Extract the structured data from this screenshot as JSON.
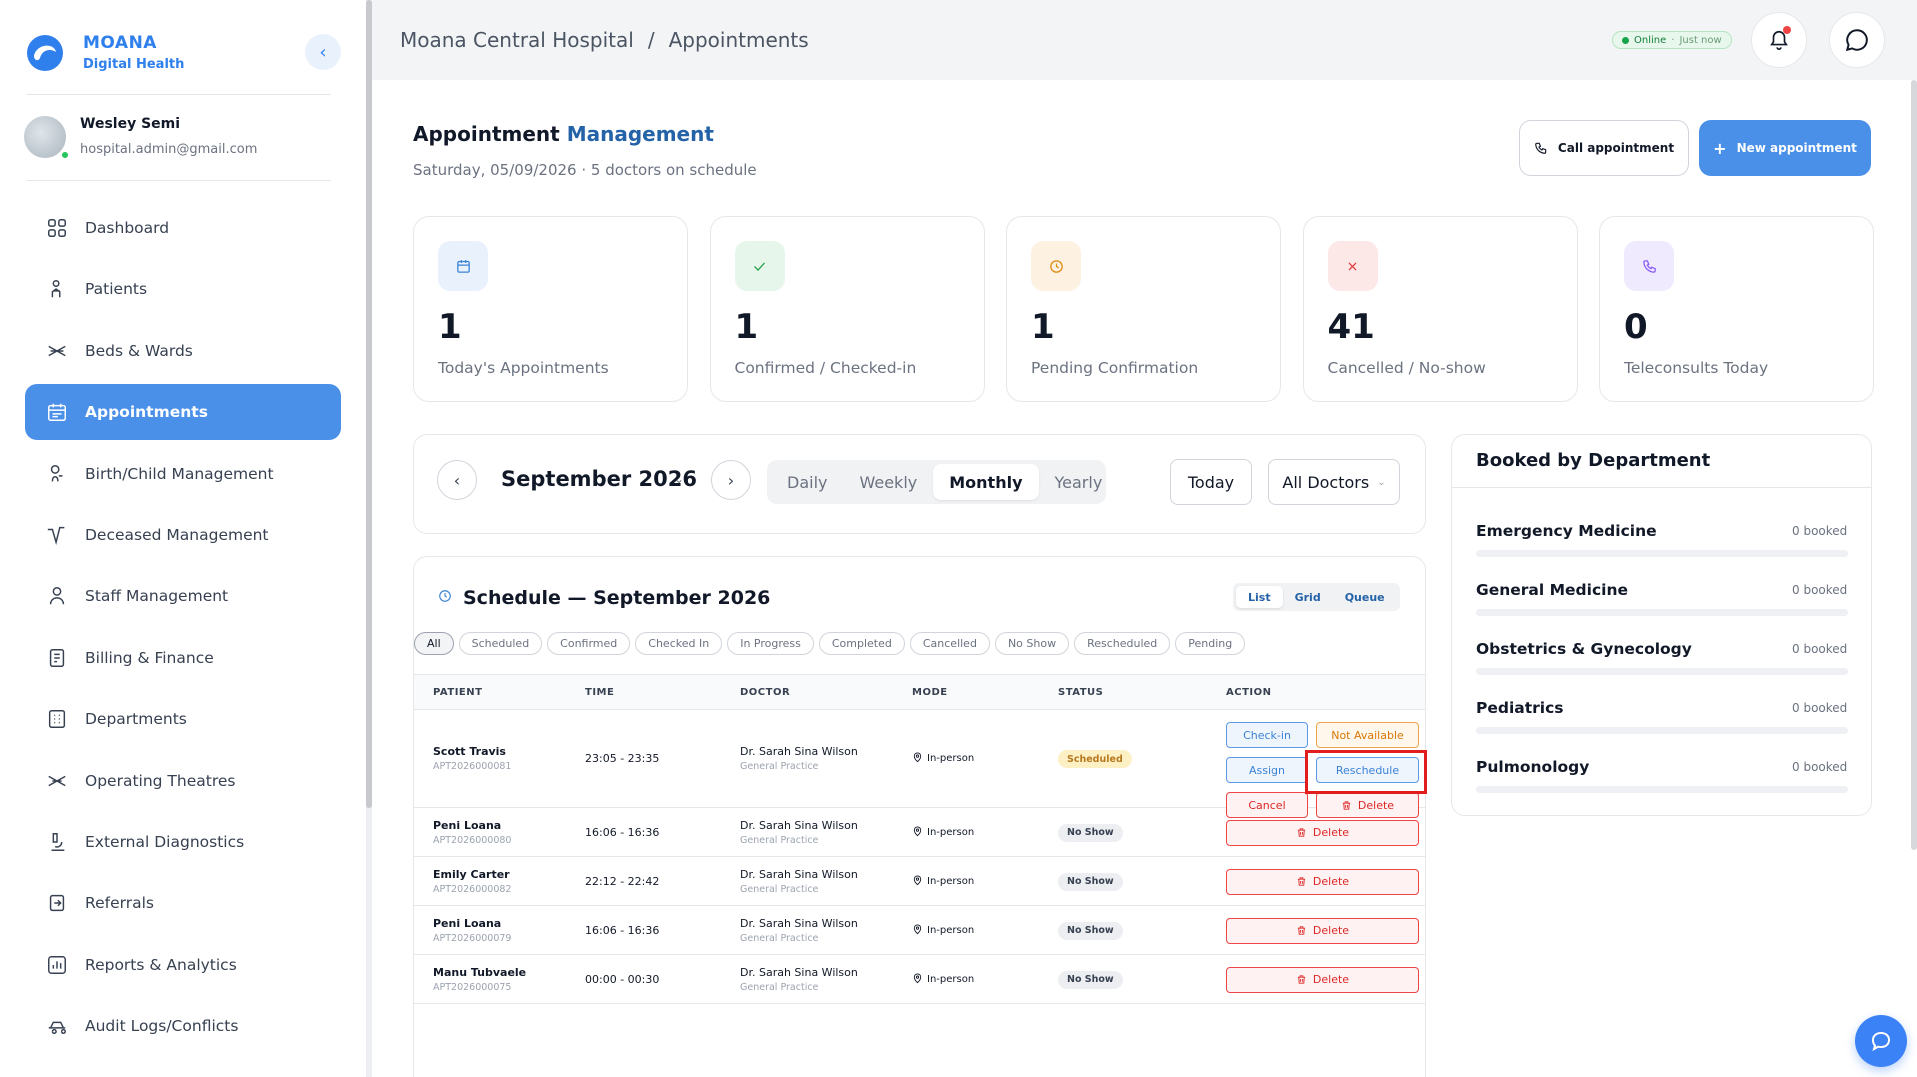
{
  "brand": {
    "name": "MOANA",
    "sub": "Digital Health"
  },
  "user": {
    "name": "Wesley Semi",
    "email": "hospital.admin@gmail.com"
  },
  "nav": [
    {
      "label": "Dashboard",
      "icon": "grid-icon"
    },
    {
      "label": "Patients",
      "icon": "patient-icon"
    },
    {
      "label": "Beds & Wards",
      "icon": "bed-icon"
    },
    {
      "label": "Appointments",
      "icon": "calendar-icon",
      "active": true
    },
    {
      "label": "Birth/Child Management",
      "icon": "baby-icon"
    },
    {
      "label": "Deceased Management",
      "icon": "pulse-icon"
    },
    {
      "label": "Staff Management",
      "icon": "staff-icon"
    },
    {
      "label": "Billing & Finance",
      "icon": "invoice-icon"
    },
    {
      "label": "Departments",
      "icon": "building-icon"
    },
    {
      "label": "Operating Theatres",
      "icon": "scissors-icon"
    },
    {
      "label": "External Diagnostics",
      "icon": "microscope-icon"
    },
    {
      "label": "Referrals",
      "icon": "referral-icon"
    },
    {
      "label": "Reports & Analytics",
      "icon": "chart-icon"
    },
    {
      "label": "Audit Logs/Conflicts",
      "icon": "audit-icon"
    }
  ],
  "breadcrumb": {
    "root": "Moana Central Hospital",
    "sep": "/",
    "current": "Appointments"
  },
  "status": {
    "online": "Online",
    "time": "Just now"
  },
  "header": {
    "title_a": "Appointment",
    "title_b": "Management",
    "subtitle": "Saturday, 05/09/2026 · 5 doctors on schedule",
    "call_label": "Call appointment",
    "new_label": "New appointment"
  },
  "stats": [
    {
      "value": "1",
      "label": "Today's Appointments",
      "icon": "calendar-icon",
      "bg": "#e8f1fc",
      "fg": "#3b82d6"
    },
    {
      "value": "1",
      "label": "Confirmed / Checked-in",
      "icon": "check-icon",
      "bg": "#e6f6ea",
      "fg": "#22a04a"
    },
    {
      "value": "1",
      "label": "Pending Confirmation",
      "icon": "clock-icon",
      "bg": "#fdf2e1",
      "fg": "#e08a14"
    },
    {
      "value": "41",
      "label": "Cancelled / No-show",
      "icon": "x-icon",
      "bg": "#fde8e8",
      "fg": "#e03b3b"
    },
    {
      "value": "0",
      "label": "Teleconsults Today",
      "icon": "phone-icon",
      "bg": "#efeafd",
      "fg": "#8b5cf6"
    }
  ],
  "calendar": {
    "month": "September 2026",
    "views": [
      "Daily",
      "Weekly",
      "Monthly",
      "Yearly"
    ],
    "active_view": "Monthly",
    "today": "Today",
    "doctor_filter": "All Doctors"
  },
  "schedule": {
    "title": "Schedule — September 2026",
    "modes": [
      "List",
      "Grid",
      "Queue"
    ],
    "filters": [
      "All",
      "Scheduled",
      "Confirmed",
      "Checked In",
      "In Progress",
      "Completed",
      "Cancelled",
      "No Show",
      "Rescheduled",
      "Pending"
    ],
    "columns": [
      "PATIENT",
      "TIME",
      "DOCTOR",
      "MODE",
      "STATUS",
      "ACTION"
    ],
    "rows": [
      {
        "name": "Scott Travis",
        "id": "APT2026000081",
        "time": "23:05 - 23:35",
        "doctor": "Dr. Sarah Sina Wilson",
        "dept": "General Practice",
        "mode": "In-person",
        "status": "Scheduled"
      },
      {
        "name": "Peni Loana",
        "id": "APT2026000080",
        "time": "16:06 - 16:36",
        "doctor": "Dr. Sarah Sina Wilson",
        "dept": "General Practice",
        "mode": "In-person",
        "status": "No Show"
      },
      {
        "name": "Emily Carter",
        "id": "APT2026000082",
        "time": "22:12 - 22:42",
        "doctor": "Dr. Sarah Sina Wilson",
        "dept": "General Practice",
        "mode": "In-person",
        "status": "No Show"
      },
      {
        "name": "Peni Loana",
        "id": "APT2026000079",
        "time": "16:06 - 16:36",
        "doctor": "Dr. Sarah Sina Wilson",
        "dept": "General Practice",
        "mode": "In-person",
        "status": "No Show"
      },
      {
        "name": "Manu Tubvaele",
        "id": "APT2026000075",
        "time": "00:00 - 00:30",
        "doctor": "Dr. Sarah Sina Wilson",
        "dept": "General Practice",
        "mode": "In-person",
        "status": "No Show"
      }
    ],
    "actions": {
      "checkin": "Check-in",
      "not_available": "Not Available",
      "assign": "Assign",
      "reschedule": "Reschedule",
      "cancel": "Cancel",
      "delete": "Delete"
    }
  },
  "departments": {
    "title": "Booked by Department",
    "items": [
      {
        "name": "Emergency Medicine",
        "count": "0 booked",
        "fill": 0
      },
      {
        "name": "General Medicine",
        "count": "0 booked",
        "fill": 0
      },
      {
        "name": "Obstetrics & Gynecology",
        "count": "0 booked",
        "fill": 0
      },
      {
        "name": "Pediatrics",
        "count": "0 booked",
        "fill": 0
      },
      {
        "name": "Pulmonology",
        "count": "0 booked",
        "fill": 0
      }
    ]
  }
}
